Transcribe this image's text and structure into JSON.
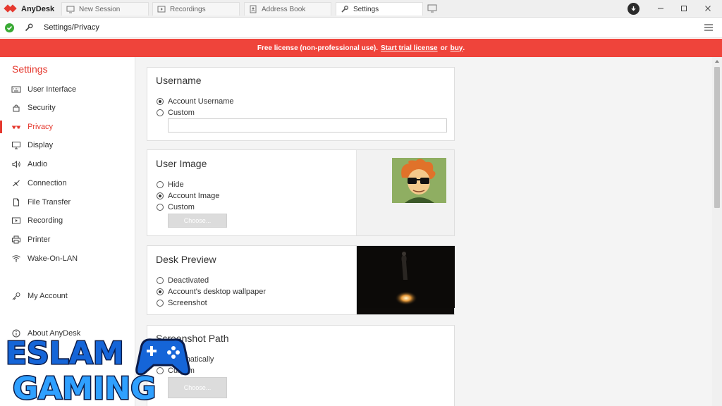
{
  "app": {
    "name": "AnyDesk"
  },
  "tabs": [
    {
      "label": "New Session",
      "icon": "monitor-icon"
    },
    {
      "label": "Recordings",
      "icon": "recording-icon"
    },
    {
      "label": "Address Book",
      "icon": "address-book-icon"
    },
    {
      "label": "Settings",
      "icon": "wrench-icon"
    }
  ],
  "active_tab": "Settings",
  "breadcrumb": "Settings/Privacy",
  "banner": {
    "text_before": "Free license (non-professional use).",
    "link_trial": "Start trial license",
    "text_or": "or",
    "link_buy": "buy",
    "text_end": ".",
    "color": "#ef443b"
  },
  "sidebar": {
    "title": "Settings",
    "items": [
      {
        "label": "User Interface",
        "icon": "keyboard-icon"
      },
      {
        "label": "Security",
        "icon": "lock-icon"
      },
      {
        "label": "Privacy",
        "icon": "privacy-glasses-icon",
        "active": true
      },
      {
        "label": "Display",
        "icon": "display-icon"
      },
      {
        "label": "Audio",
        "icon": "speaker-icon"
      },
      {
        "label": "Connection",
        "icon": "connection-icon"
      },
      {
        "label": "File Transfer",
        "icon": "file-icon"
      },
      {
        "label": "Recording",
        "icon": "recording-icon"
      },
      {
        "label": "Printer",
        "icon": "printer-icon"
      },
      {
        "label": "Wake-On-LAN",
        "icon": "wifi-icon"
      },
      {
        "label": "My Account",
        "icon": "key-icon"
      },
      {
        "label": "About AnyDesk",
        "icon": "info-icon"
      }
    ],
    "accent": "#e5392f"
  },
  "sections": {
    "username": {
      "title": "Username",
      "options": [
        "Account Username",
        "Custom"
      ],
      "selected": "Account Username",
      "custom_value": ""
    },
    "user_image": {
      "title": "User Image",
      "options": [
        "Hide",
        "Account Image",
        "Custom"
      ],
      "selected": "Account Image",
      "choose_label": "Choose..."
    },
    "desk_preview": {
      "title": "Desk Preview",
      "options": [
        "Deactivated",
        "Account's desktop wallpaper",
        "Screenshot"
      ],
      "selected": "Account's desktop wallpaper"
    },
    "screenshot_path": {
      "title": "Screenshot Path",
      "options": [
        "Automatically",
        "Custom"
      ],
      "choose_label": "Choose..."
    }
  },
  "watermark": {
    "line1": "ESLAM",
    "line2": "GAMING"
  }
}
